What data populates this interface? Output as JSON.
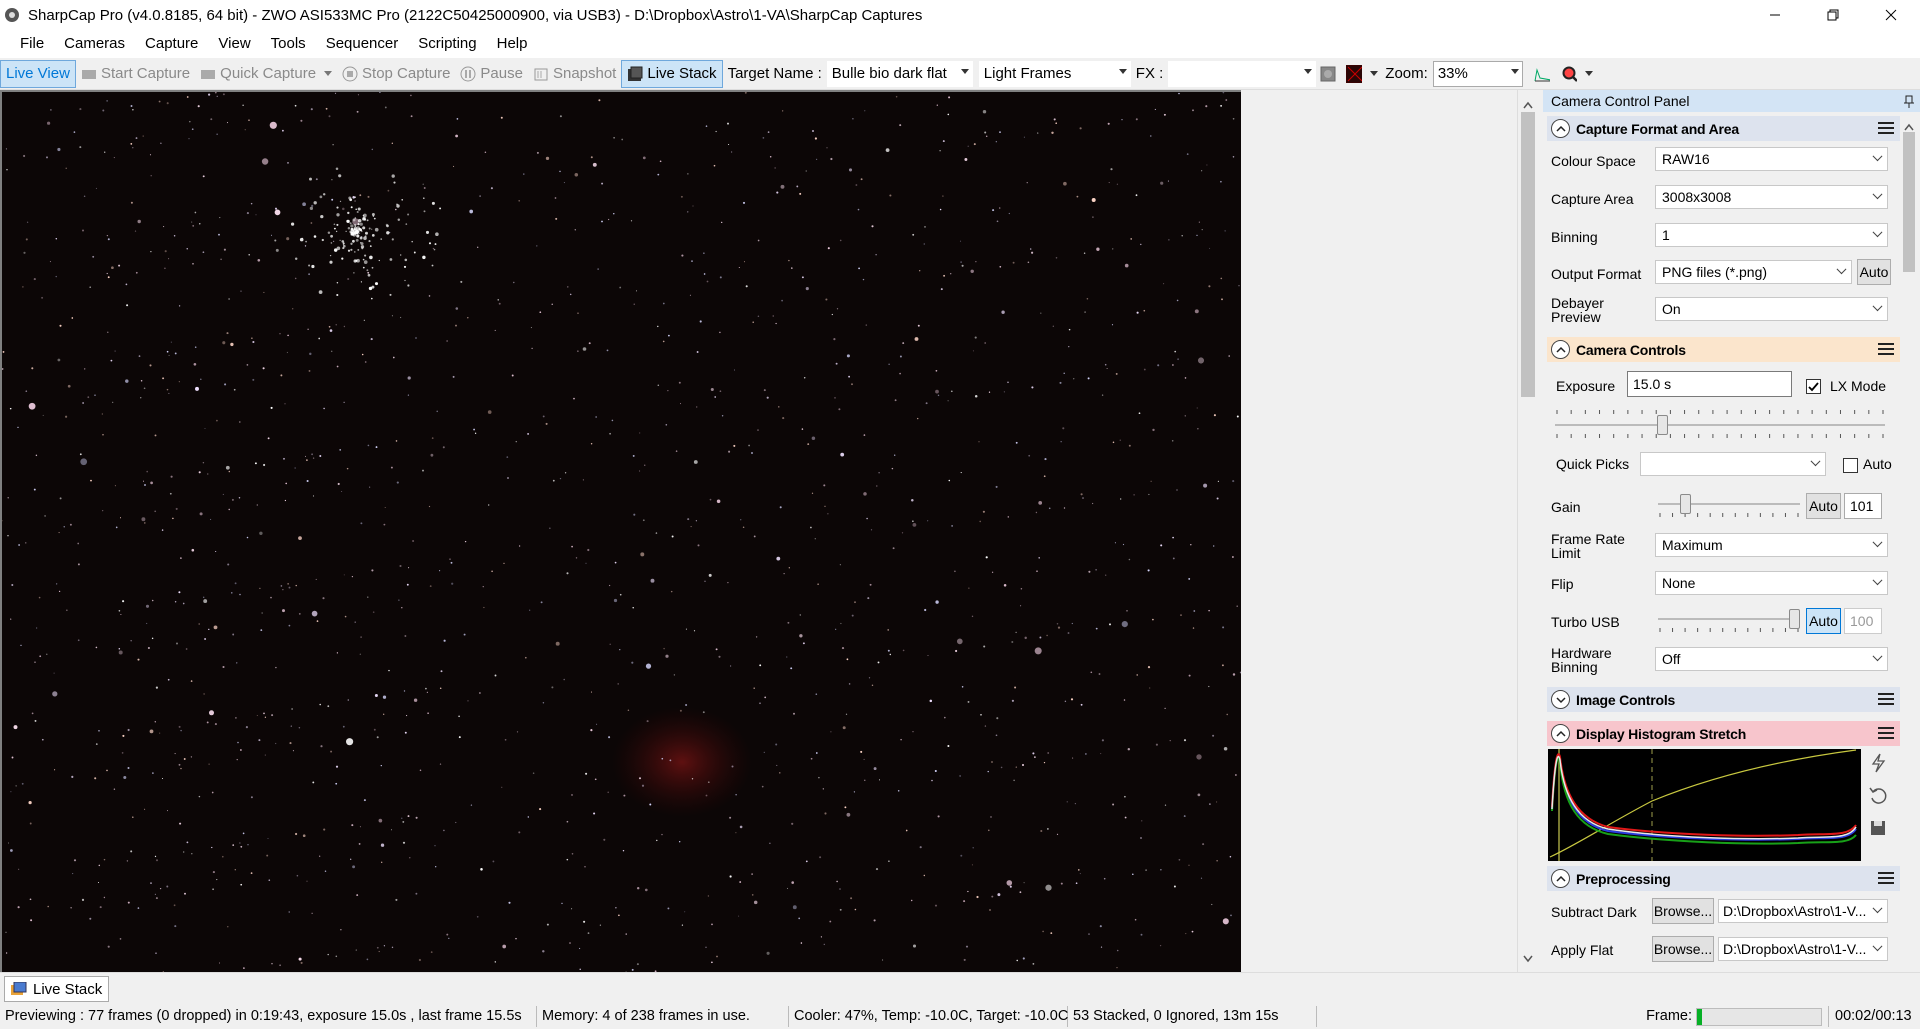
{
  "window": {
    "title": "SharpCap Pro (v4.0.8185, 64 bit) - ZWO ASI533MC Pro (2122C50425000900, via USB3) - D:\\Dropbox\\Astro\\1-VA\\SharpCap Captures"
  },
  "menu": [
    "File",
    "Cameras",
    "Capture",
    "View",
    "Tools",
    "Sequencer",
    "Scripting",
    "Help"
  ],
  "toolbar": {
    "live_view": "Live View",
    "start_capture": "Start Capture",
    "quick_capture": "Quick Capture",
    "stop_capture": "Stop Capture",
    "pause": "Pause",
    "snapshot": "Snapshot",
    "live_stack": "Live Stack",
    "target_name_label": "Target Name :",
    "target_name_value": "Bulle bio dark flat",
    "frame_type_value": "Light Frames",
    "fx_label": "FX :",
    "fx_value": "",
    "zoom_label": "Zoom:",
    "zoom_value": "33%"
  },
  "panel": {
    "title": "Camera Control Panel",
    "capture_format": {
      "header": "Capture Format and Area",
      "colour_space_label": "Colour Space",
      "colour_space_value": "RAW16",
      "capture_area_label": "Capture Area",
      "capture_area_value": "3008x3008",
      "binning_label": "Binning",
      "binning_value": "1",
      "output_format_label": "Output Format",
      "output_format_value": "PNG files (*.png)",
      "output_auto": "Auto",
      "debayer_label_1": "Debayer",
      "debayer_label_2": "Preview",
      "debayer_value": "On"
    },
    "camera_controls": {
      "header": "Camera Controls",
      "exposure_label": "Exposure",
      "exposure_value": "15.0 s",
      "lx_mode_label": "LX Mode",
      "lx_mode_checked": true,
      "exposure_slider_fraction": 0.32,
      "quick_picks_label": "Quick Picks",
      "quick_picks_value": "",
      "quick_auto_label": "Auto",
      "gain_label": "Gain",
      "gain_auto": "Auto",
      "gain_value": "101",
      "gain_slider_fraction": 0.17,
      "frame_rate_label_1": "Frame Rate",
      "frame_rate_label_2": "Limit",
      "frame_rate_value": "Maximum",
      "flip_label": "Flip",
      "flip_value": "None",
      "turbo_label": "Turbo USB",
      "turbo_auto": "Auto",
      "turbo_value": "100",
      "turbo_slider_fraction": 1.0,
      "hw_binning_label_1": "Hardware",
      "hw_binning_label_2": "Binning",
      "hw_binning_value": "Off"
    },
    "image_controls": {
      "header": "Image Controls"
    },
    "histogram": {
      "header": "Display Histogram Stretch"
    },
    "preprocessing": {
      "header": "Preprocessing",
      "subtract_dark_label": "Subtract Dark",
      "subtract_dark_browse": "Browse...",
      "subtract_dark_value": "D:\\Dropbox\\Astro\\1-V...",
      "apply_flat_label": "Apply Flat",
      "apply_flat_browse": "Browse...",
      "apply_flat_value": "D:\\Dropbox\\Astro\\1-V..."
    }
  },
  "tab": {
    "label": "Live Stack"
  },
  "status": {
    "previewing": "Previewing : 77 frames (0 dropped) in 0:19:43, exposure 15.0s , last frame 15.5s",
    "memory": "Memory: 4 of 238 frames in use.",
    "cooler": "Cooler: 47%, Temp: -10.0C, Target: -10.0C",
    "stacked": "53 Stacked, 0 Ignored, 13m 15s",
    "frame_label": "Frame:",
    "frame_progress": 0.04,
    "frame_time": "00:02/00:13"
  },
  "colors": {
    "histogram_header": "#f7c5cc",
    "camera_controls_header": "#fbe5cc",
    "section_header": "#dde3ee",
    "accent_blue": "#0078d7",
    "progress_green": "#06b025"
  }
}
